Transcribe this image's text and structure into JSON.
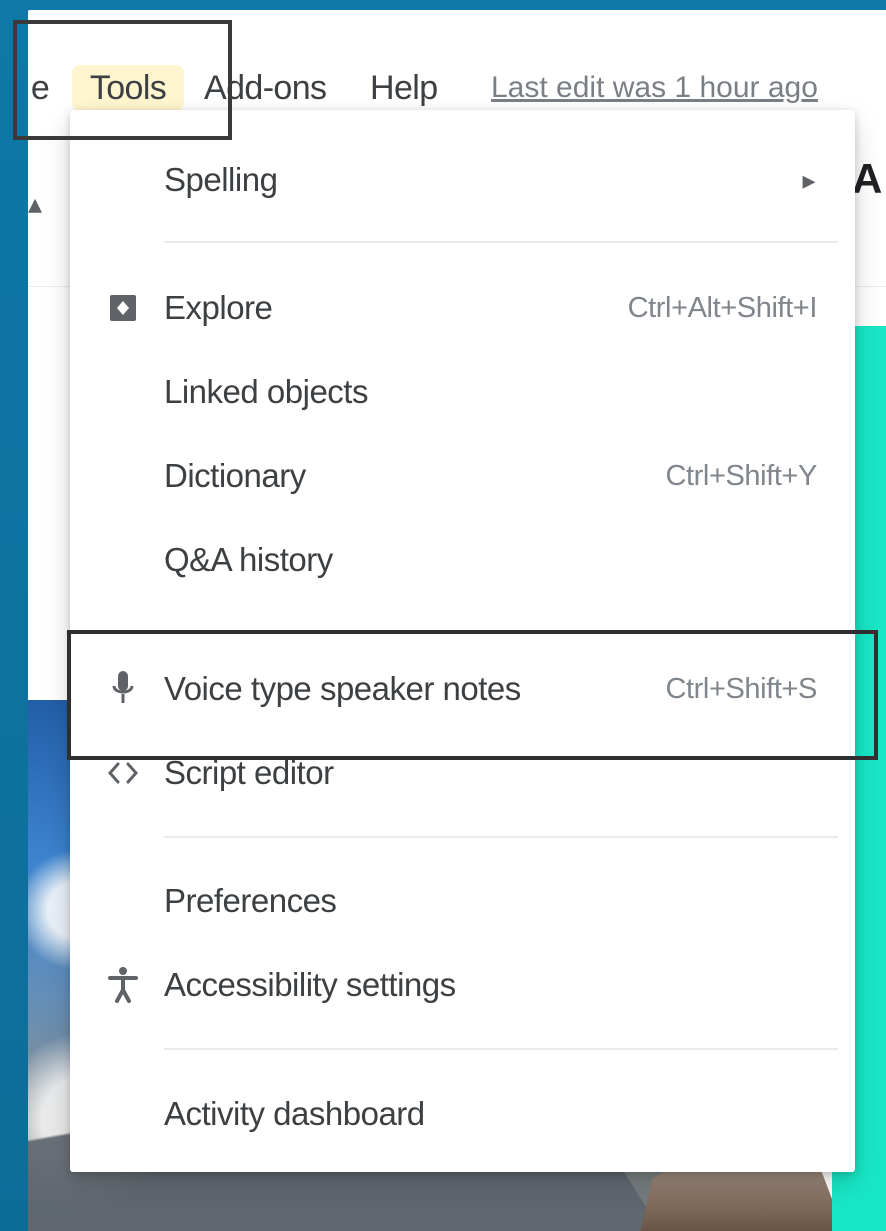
{
  "menu_bar": {
    "partial_left_item": "e",
    "tools": "Tools",
    "addons": "Add-ons",
    "help": "Help",
    "last_edit": "Last edit was 1 hour ago"
  },
  "tools_menu": {
    "items": [
      {
        "label": "Spelling",
        "submenu_indicator": "▸"
      },
      {
        "label": "Explore",
        "shortcut": "Ctrl+Alt+Shift+I",
        "icon": "explore-icon"
      },
      {
        "label": "Linked objects"
      },
      {
        "label": "Dictionary",
        "shortcut": "Ctrl+Shift+Y"
      },
      {
        "label": "Q&A history"
      },
      {
        "label": "Voice type speaker notes",
        "shortcut": "Ctrl+Shift+S",
        "icon": "microphone-icon"
      },
      {
        "label": "Script editor",
        "icon": "code-icon"
      },
      {
        "label": "Preferences"
      },
      {
        "label": "Accessibility settings",
        "icon": "accessibility-icon"
      },
      {
        "label": "Activity dashboard"
      }
    ]
  },
  "colors": {
    "frame_blue": "#0e78a8",
    "menu_highlight": "#fff5cf",
    "accent_teal": "#18e7c6",
    "text_primary": "#3c4043",
    "text_secondary": "#80868b"
  }
}
